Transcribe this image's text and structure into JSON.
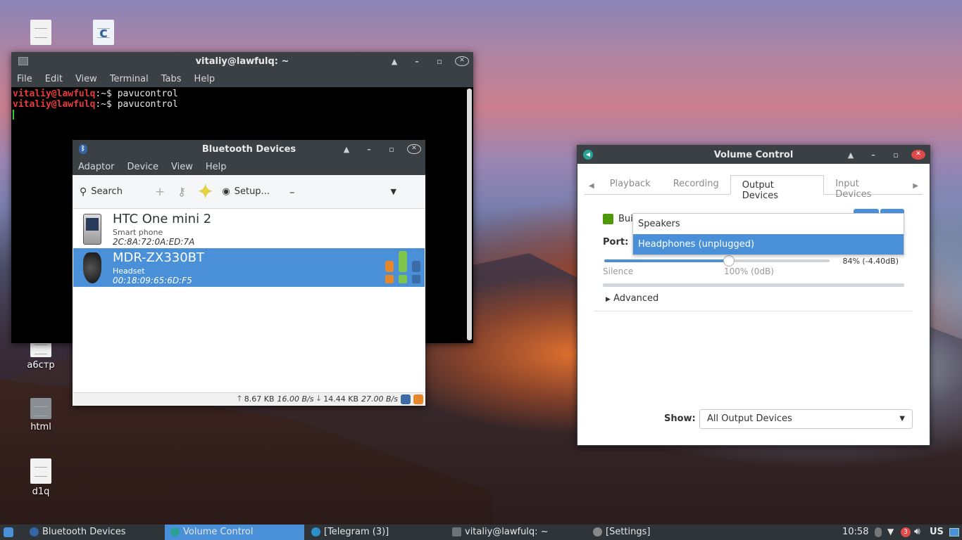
{
  "desktop": {
    "icons": [
      {
        "label": "a6cтp"
      },
      {
        "label": "html"
      },
      {
        "label": "d1q"
      },
      {
        "label": "c"
      }
    ]
  },
  "terminal": {
    "title": "vitaliy@lawfulq: ~",
    "menu": [
      "File",
      "Edit",
      "View",
      "Terminal",
      "Tabs",
      "Help"
    ],
    "lines": [
      {
        "prompt": "vitaliy@lawfulq",
        "rest": ":~$ pavucontrol"
      },
      {
        "prompt": "vitaliy@lawfulq",
        "rest": ":~$ pavucontrol"
      }
    ]
  },
  "bluetooth": {
    "title": "Bluetooth Devices",
    "menu": [
      "Adaptor",
      "Device",
      "View",
      "Help"
    ],
    "toolbar": {
      "search": "Search",
      "setup": "Setup..."
    },
    "devices": [
      {
        "name": "HTC One mini 2",
        "type": "Smart phone",
        "address": "2C:8A:72:0A:ED:7A"
      },
      {
        "name": "MDR-ZX330BT",
        "type": "Headset",
        "address": "00:18:09:65:6D:F5"
      }
    ],
    "status": {
      "up_total": "8.67 KB",
      "up_rate": "16.00 B/s",
      "down_total": "14.44 KB",
      "down_rate": "27.00 B/s"
    }
  },
  "volume": {
    "title": "Volume Control",
    "tabs": [
      "Playback",
      "Recording",
      "Output Devices",
      "Input Devices"
    ],
    "active_tab": "Output Devices",
    "device_label": "Bui",
    "port_label": "Port:",
    "port_options": [
      "Speakers",
      "Headphones (unplugged)"
    ],
    "selected_port": "Headphones (unplugged)",
    "volume_percent": 84,
    "volume_readout": "84% (-4.40dB)",
    "scale_silence": "Silence",
    "scale_100": "100% (0dB)",
    "advanced": "Advanced",
    "show_label": "Show:",
    "show_value": "All Output Devices"
  },
  "taskbar": {
    "items": [
      "Bluetooth Devices",
      "Volume Control",
      "[Telegram (3)]",
      "vitaliy@lawfulq: ~",
      "[Settings]"
    ],
    "active": "Volume Control",
    "clock": "10:58",
    "keyboard": "US",
    "telegram_badge": "3"
  },
  "colors": {
    "accent": "#4a90d9",
    "titlebar": "#3b4045",
    "taskbar": "#2f3438",
    "close_red": "#e04a4a"
  }
}
